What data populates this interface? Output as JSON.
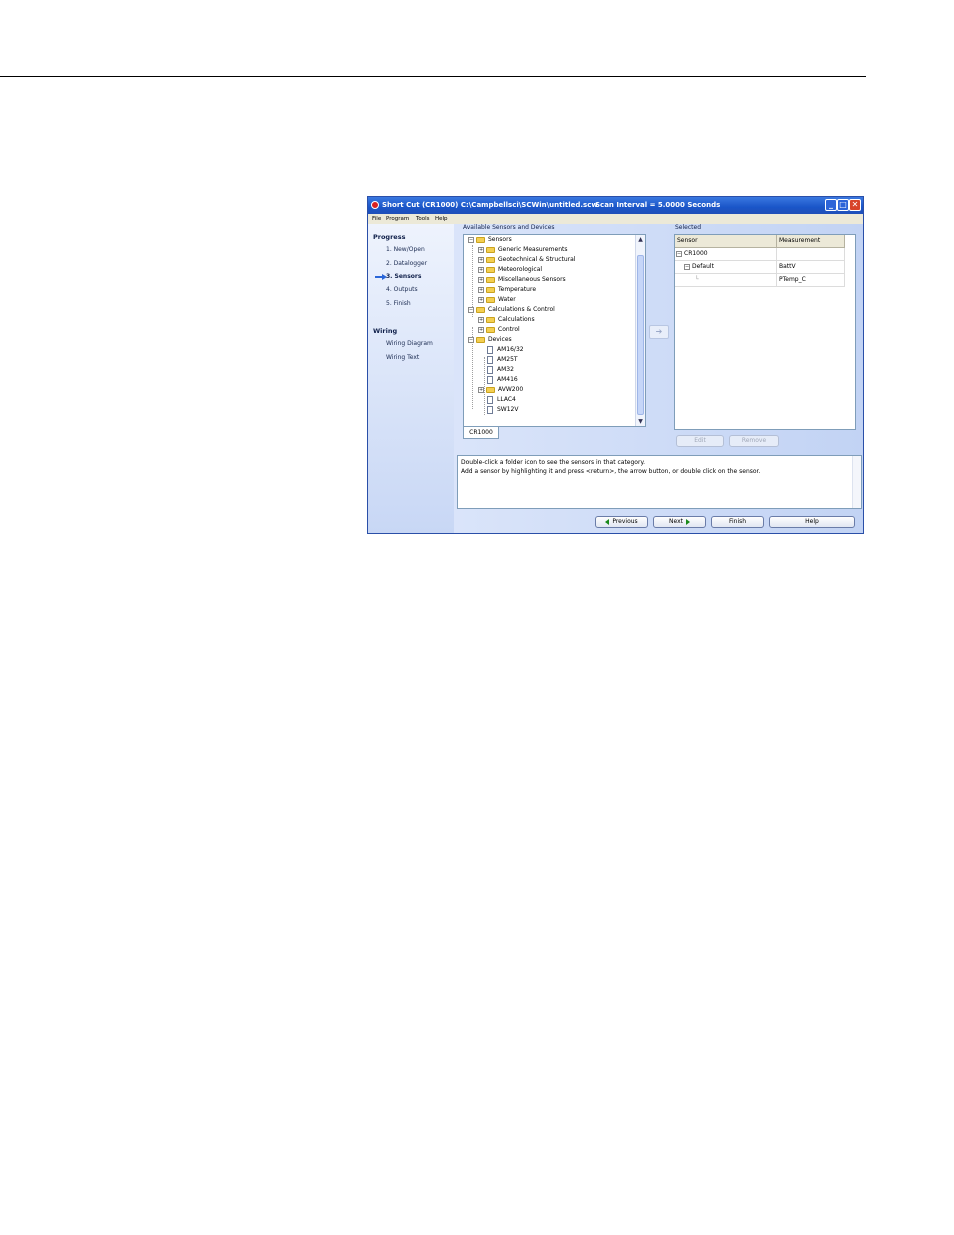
{
  "window": {
    "title": "Short Cut (CR1000) C:\\Campbellsci\\SCWin\\untitled.scw",
    "scan_interval": "Scan Interval = 5.0000 Seconds",
    "controls": {
      "minimize": "_",
      "maximize": "□",
      "close": "✕"
    },
    "colors": {
      "titlebar": "#1a55c8",
      "close": "#d8442a",
      "panel": "#c2d3f4"
    }
  },
  "menu": [
    "File",
    "Program",
    "Tools",
    "Help"
  ],
  "progress": {
    "heading": "Progress",
    "steps": [
      "1. New/Open",
      "2. Datalogger",
      "3. Sensors",
      "4. Outputs",
      "5. Finish"
    ],
    "active_step": 3
  },
  "wiring": {
    "heading": "Wiring",
    "items": [
      "Wiring Diagram",
      "Wiring Text"
    ]
  },
  "available": {
    "label": "Available Sensors and Devices",
    "tab": "CR1000",
    "tree": [
      {
        "label": "Sensors",
        "type": "folder",
        "expanded": true
      },
      {
        "label": "Generic Measurements",
        "type": "folder"
      },
      {
        "label": "Geotechnical & Structural",
        "type": "folder"
      },
      {
        "label": "Meteorological",
        "type": "folder"
      },
      {
        "label": "Miscellaneous Sensors",
        "type": "folder"
      },
      {
        "label": "Temperature",
        "type": "folder"
      },
      {
        "label": "Water",
        "type": "folder"
      },
      {
        "label": "Calculations & Control",
        "type": "folder",
        "expanded": true
      },
      {
        "label": "Calculations",
        "type": "folder"
      },
      {
        "label": "Control",
        "type": "folder"
      },
      {
        "label": "Devices",
        "type": "folder",
        "expanded": true
      },
      {
        "label": "AM16/32",
        "type": "device"
      },
      {
        "label": "AM25T",
        "type": "device"
      },
      {
        "label": "AM32",
        "type": "device"
      },
      {
        "label": "AM416",
        "type": "device"
      },
      {
        "label": "AVW200",
        "type": "folder"
      },
      {
        "label": "LLAC4",
        "type": "device"
      },
      {
        "label": "SW12V",
        "type": "device"
      }
    ]
  },
  "selected": {
    "label": "Selected",
    "columns": [
      "Sensor",
      "Measurement"
    ],
    "rows": [
      {
        "sensor": "CR1000",
        "measurement": ""
      },
      {
        "sensor": "Default",
        "measurement": "BattV"
      },
      {
        "sensor": "",
        "measurement": "PTemp_C"
      }
    ],
    "edit_label": "Edit",
    "remove_label": "Remove"
  },
  "description": {
    "line1": "Double-click a folder icon to see the sensors in that category.",
    "line2": "Add a sensor by highlighting it and press <return>, the arrow button, or double click on the sensor."
  },
  "buttons": {
    "previous": "Previous",
    "next": "Next",
    "finish": "Finish",
    "help": "Help"
  }
}
